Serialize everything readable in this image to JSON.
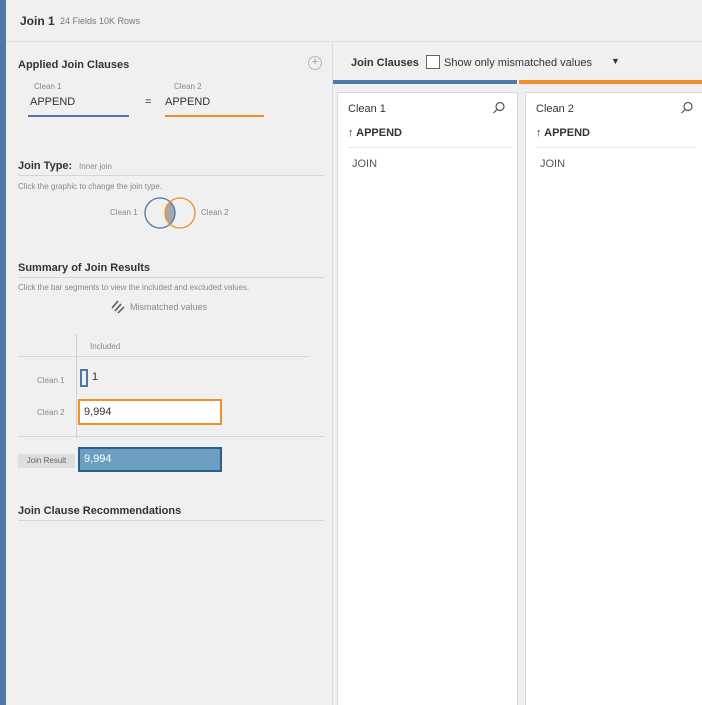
{
  "header": {
    "title": "Join 1",
    "meta": "24 Fields  10K Rows"
  },
  "applied_join_clauses": {
    "title": "Applied Join Clauses",
    "left_label": "Clean 1",
    "right_label": "Clean 2",
    "left_value": "APPEND",
    "operator": "=",
    "right_value": "APPEND",
    "add_icon": "plus-circle-icon"
  },
  "join_type": {
    "title": "Join Type:",
    "value": "Inner join",
    "hint": "Click the graphic to change the join type.",
    "left_label": "Clean 1",
    "right_label": "Clean 2"
  },
  "summary": {
    "title": "Summary of Join Results",
    "hint": "Click the bar segments to view the included and excluded values.",
    "legend": "Mismatched values",
    "column_header": "Included",
    "rows": [
      {
        "label": "Clean 1",
        "value": "1"
      },
      {
        "label": "Clean 2",
        "value": "9,994"
      }
    ],
    "result_label": "Join Result",
    "result_value": "9,994"
  },
  "recommendations": {
    "title": "Join Clause Recommendations"
  },
  "right_panel": {
    "title": "Join Clauses",
    "checkbox_label": "Show only mismatched values",
    "checkbox_checked": false,
    "columns": [
      {
        "name": "Clean 1",
        "field": "↑ APPEND",
        "values": [
          "JOIN"
        ],
        "color": "#4e79a7"
      },
      {
        "name": "Clean 2",
        "field": "↑ APPEND",
        "values": [
          "JOIN"
        ],
        "color": "#f28e2b"
      }
    ]
  },
  "colors": {
    "clean1": "#4e79a7",
    "clean2": "#f28e2b",
    "result": "#6b9ec0",
    "sidebar": "#4e79a7"
  }
}
